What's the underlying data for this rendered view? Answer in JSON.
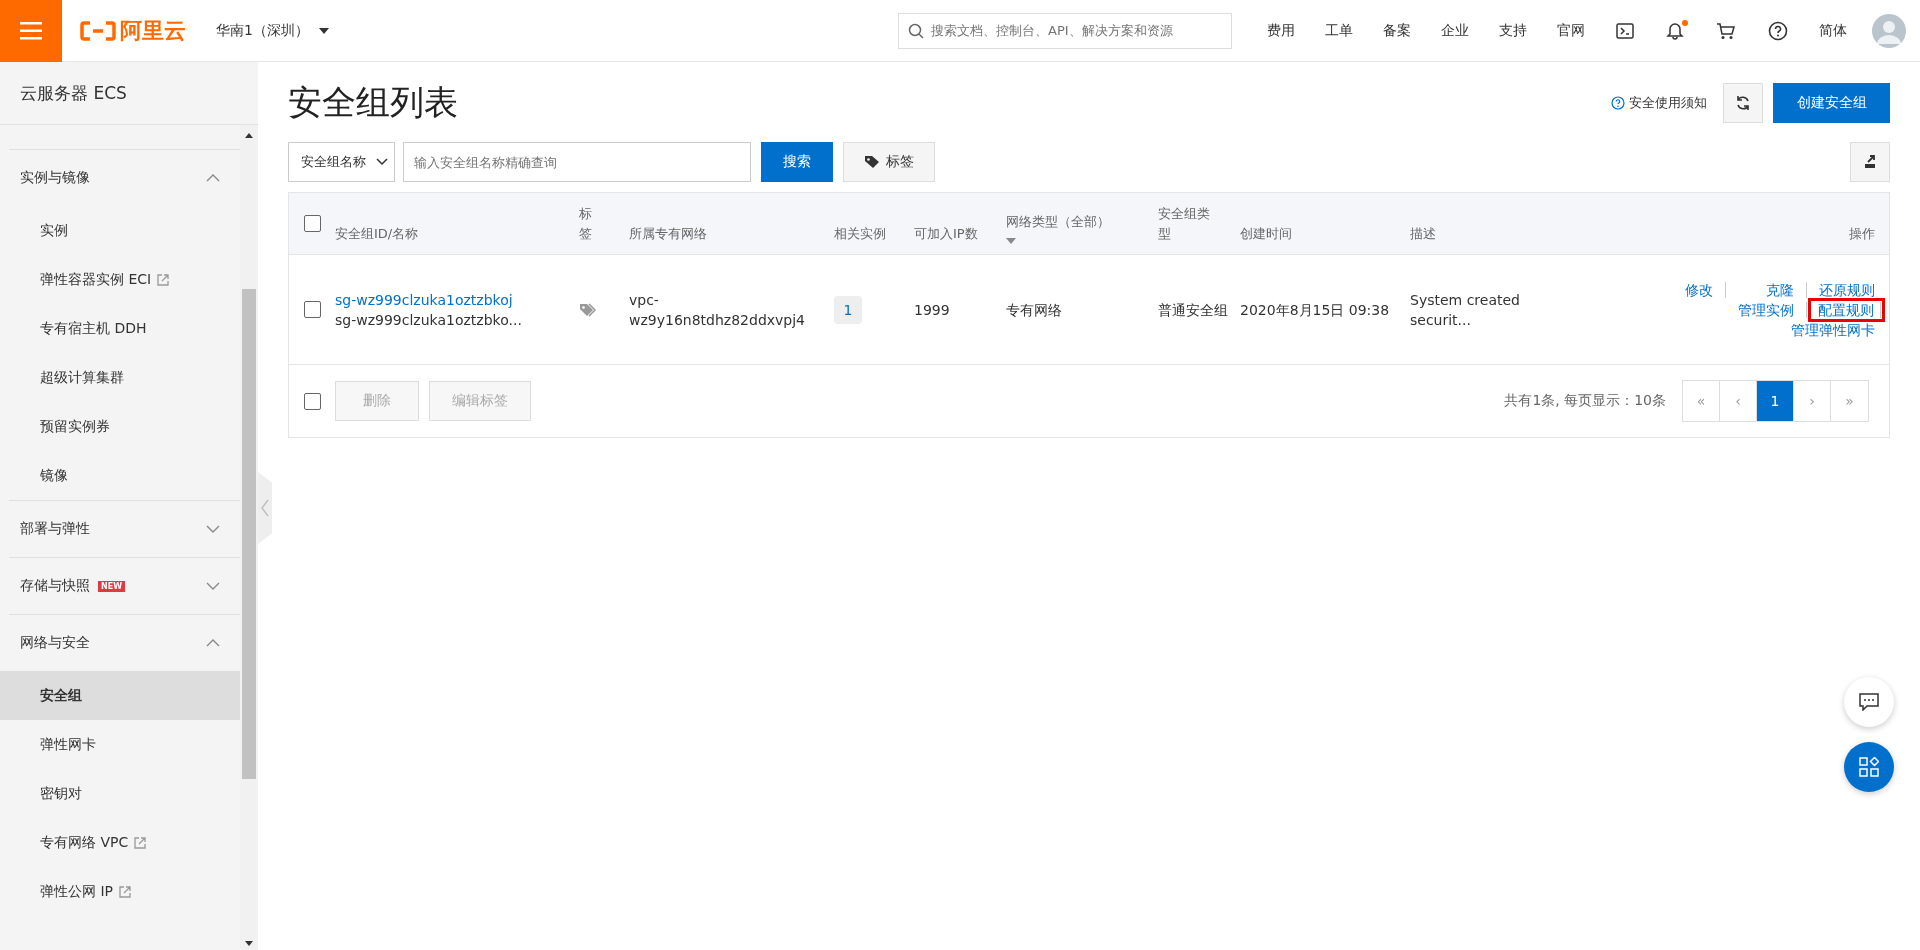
{
  "topbar": {
    "logo": "阿里云",
    "region": "华南1（深圳）",
    "search": {
      "placeholder": "搜索文档、控制台、API、解决方案和资源"
    },
    "links": [
      "费用",
      "工单",
      "备案",
      "企业",
      "支持",
      "官网"
    ],
    "language": "简体",
    "notification_dot": true
  },
  "sidebar": {
    "title": "云服务器 ECS",
    "groups": [
      {
        "label": "实例与镜像",
        "expanded": true,
        "children": [
          {
            "label": "实例",
            "external": false,
            "selected": false
          },
          {
            "label": "弹性容器实例 ECI",
            "external": true,
            "selected": false
          },
          {
            "label": "专有宿主机 DDH",
            "external": false,
            "selected": false
          },
          {
            "label": "超级计算集群",
            "external": false,
            "selected": false
          },
          {
            "label": "预留实例券",
            "external": false,
            "selected": false
          },
          {
            "label": "镜像",
            "external": false,
            "selected": false
          }
        ]
      },
      {
        "label": "部署与弹性",
        "expanded": false
      },
      {
        "label": "存储与快照",
        "badge": "NEW",
        "expanded": false
      },
      {
        "label": "网络与安全",
        "expanded": true,
        "children": [
          {
            "label": "安全组",
            "external": false,
            "selected": true
          },
          {
            "label": "弹性网卡",
            "external": false,
            "selected": false
          },
          {
            "label": "密钥对",
            "external": false,
            "selected": false
          },
          {
            "label": "专有网络 VPC",
            "external": true,
            "selected": false
          },
          {
            "label": "弹性公网 IP",
            "external": true,
            "selected": false
          }
        ]
      }
    ]
  },
  "page": {
    "title": "安全组列表",
    "help_link": "安全使用须知",
    "create_button": "创建安全组"
  },
  "filter": {
    "field_select": "安全组名称",
    "search": {
      "placeholder": "输入安全组名称精确查询"
    },
    "search_button": "搜索",
    "tag_button": "标签"
  },
  "table": {
    "select_all": false,
    "columns": [
      {
        "label": "安全组ID/名称",
        "sortable": false
      },
      {
        "label": "标签",
        "sortable": false
      },
      {
        "label": "所属专有网络",
        "sortable": false
      },
      {
        "label": "相关实例",
        "sortable": false
      },
      {
        "label": "可加入IP数",
        "sortable": false
      },
      {
        "label": "网络类型（全部）",
        "sortable": true
      },
      {
        "label": "安全组类型",
        "sortable": false
      },
      {
        "label": "创建时间",
        "sortable": false
      },
      {
        "label": "描述",
        "sortable": false
      },
      {
        "label": "操作",
        "sortable": false
      }
    ],
    "rows": [
      {
        "checked": false,
        "id": "sg-wz999clzuka1oztzbkoj",
        "name": "sg-wz999clzuka1oztzbko...",
        "vpc": "vpc-wz9y16n8tdhz82ddxvpj4",
        "instances": "1",
        "ip_count": "1999",
        "network_type": "专有网络",
        "group_type": "普通安全组",
        "created": "2020年8月15日 09:38",
        "description": "System created securit...",
        "actions": [
          {
            "label": "修改",
            "highlighted": false
          },
          {
            "label": "克隆",
            "highlighted": false
          },
          {
            "label": "还原规则",
            "highlighted": false
          },
          {
            "label": "管理实例",
            "highlighted": false
          },
          {
            "label": "配置规则",
            "highlighted": true
          },
          {
            "label": "管理弹性网卡",
            "highlighted": false
          }
        ]
      }
    ]
  },
  "footer": {
    "checked": false,
    "buttons": [
      {
        "label": "删除",
        "disabled": true
      },
      {
        "label": "编辑标签",
        "disabled": true
      }
    ],
    "summary": "共有1条, 每页显示：10条",
    "pages": [
      {
        "label": "«",
        "selected": false
      },
      {
        "label": "‹",
        "selected": false
      },
      {
        "label": "1",
        "selected": true
      },
      {
        "label": "›",
        "selected": false
      },
      {
        "label": "»",
        "selected": false
      }
    ]
  }
}
